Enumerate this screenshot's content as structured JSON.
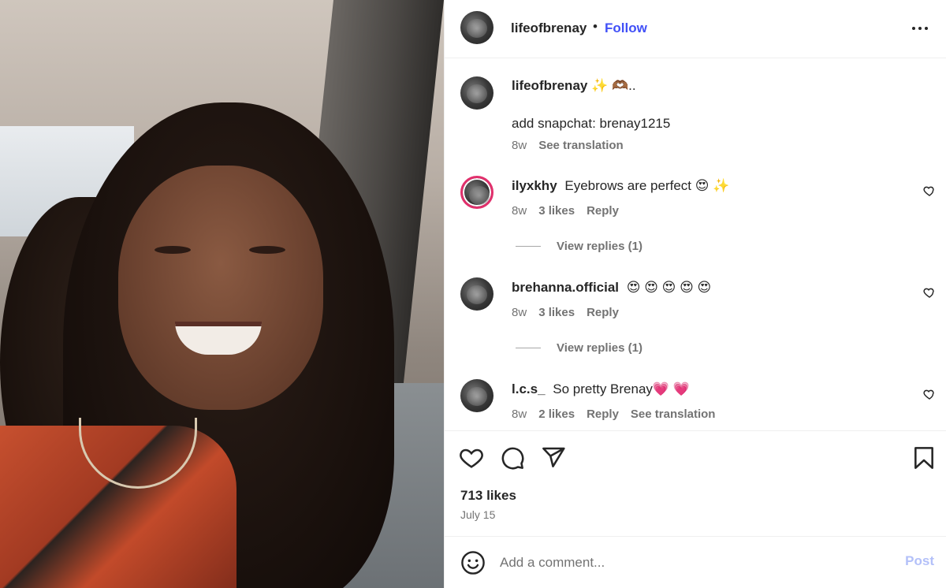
{
  "post": {
    "author": "lifeofbrenay",
    "follow_label": "Follow",
    "dot": "•",
    "more_icon": "more-horizontal-icon",
    "photo_alt": "Selfie in a car"
  },
  "caption": {
    "username": "lifeofbrenay",
    "emoji": "✨ 🫶🏾..",
    "text": "add snapchat: brenay1215",
    "age": "8w",
    "see_translation": "See translation"
  },
  "comments": [
    {
      "username": "ilyxkhy",
      "text": "Eyebrows are perfect 😍 ✨",
      "age": "8w",
      "likes": "3 likes",
      "reply": "Reply",
      "view_replies": "View replies (1)"
    },
    {
      "username": "brehanna.official",
      "text": "😍 😍 😍 😍 😍",
      "age": "8w",
      "likes": "3 likes",
      "reply": "Reply",
      "view_replies": "View replies (1)"
    },
    {
      "username": "l.c.s_",
      "text": "So pretty Brenay💗 💗",
      "age": "8w",
      "likes": "2 likes",
      "reply": "Reply",
      "see_translation": "See translation"
    }
  ],
  "actions": {
    "likes": "713 likes",
    "date": "July 15"
  },
  "composer": {
    "placeholder": "Add a comment...",
    "post_label": "Post"
  }
}
